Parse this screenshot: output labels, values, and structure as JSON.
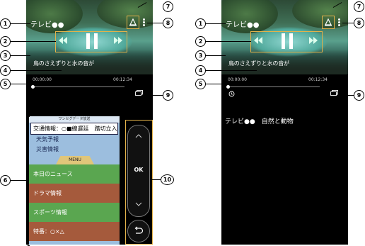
{
  "screen_left": {
    "channel_title": "テレビ●●",
    "subtitle": "鳥のさえずりと水の音が",
    "time_start": "00:00:00",
    "time_end": "00:12:34",
    "data_panel": {
      "header": "ワンセグデータ放送",
      "traffic": "交通情報：○■線遅延　踏切立入",
      "weather": "天気予報",
      "disaster": "災害情報",
      "menu_tab": "MENU",
      "items": [
        "本日のニュース",
        "ドラマ情報",
        "スポーツ情報",
        "特番：○×△"
      ]
    },
    "dpad": {
      "ok_label": "OK"
    }
  },
  "screen_right": {
    "channel_title": "テレビ●●",
    "subtitle": "鳥のさえずりと水の音が",
    "time_start": "00:00:00",
    "time_end": "00:12:34",
    "program_info": "テレビ●●　自然と動物"
  },
  "callouts": {
    "c1": "1",
    "c2": "2",
    "c3": "3",
    "c4": "4",
    "c5": "5",
    "c6": "6",
    "c7": "7",
    "c8": "8",
    "c9": "9",
    "c10": "10"
  },
  "colors": {
    "accent_frame": "#e3b24a",
    "panel_blue": "#9cbede",
    "menu_green": "#5aa650",
    "menu_brown": "#a55a3c"
  }
}
